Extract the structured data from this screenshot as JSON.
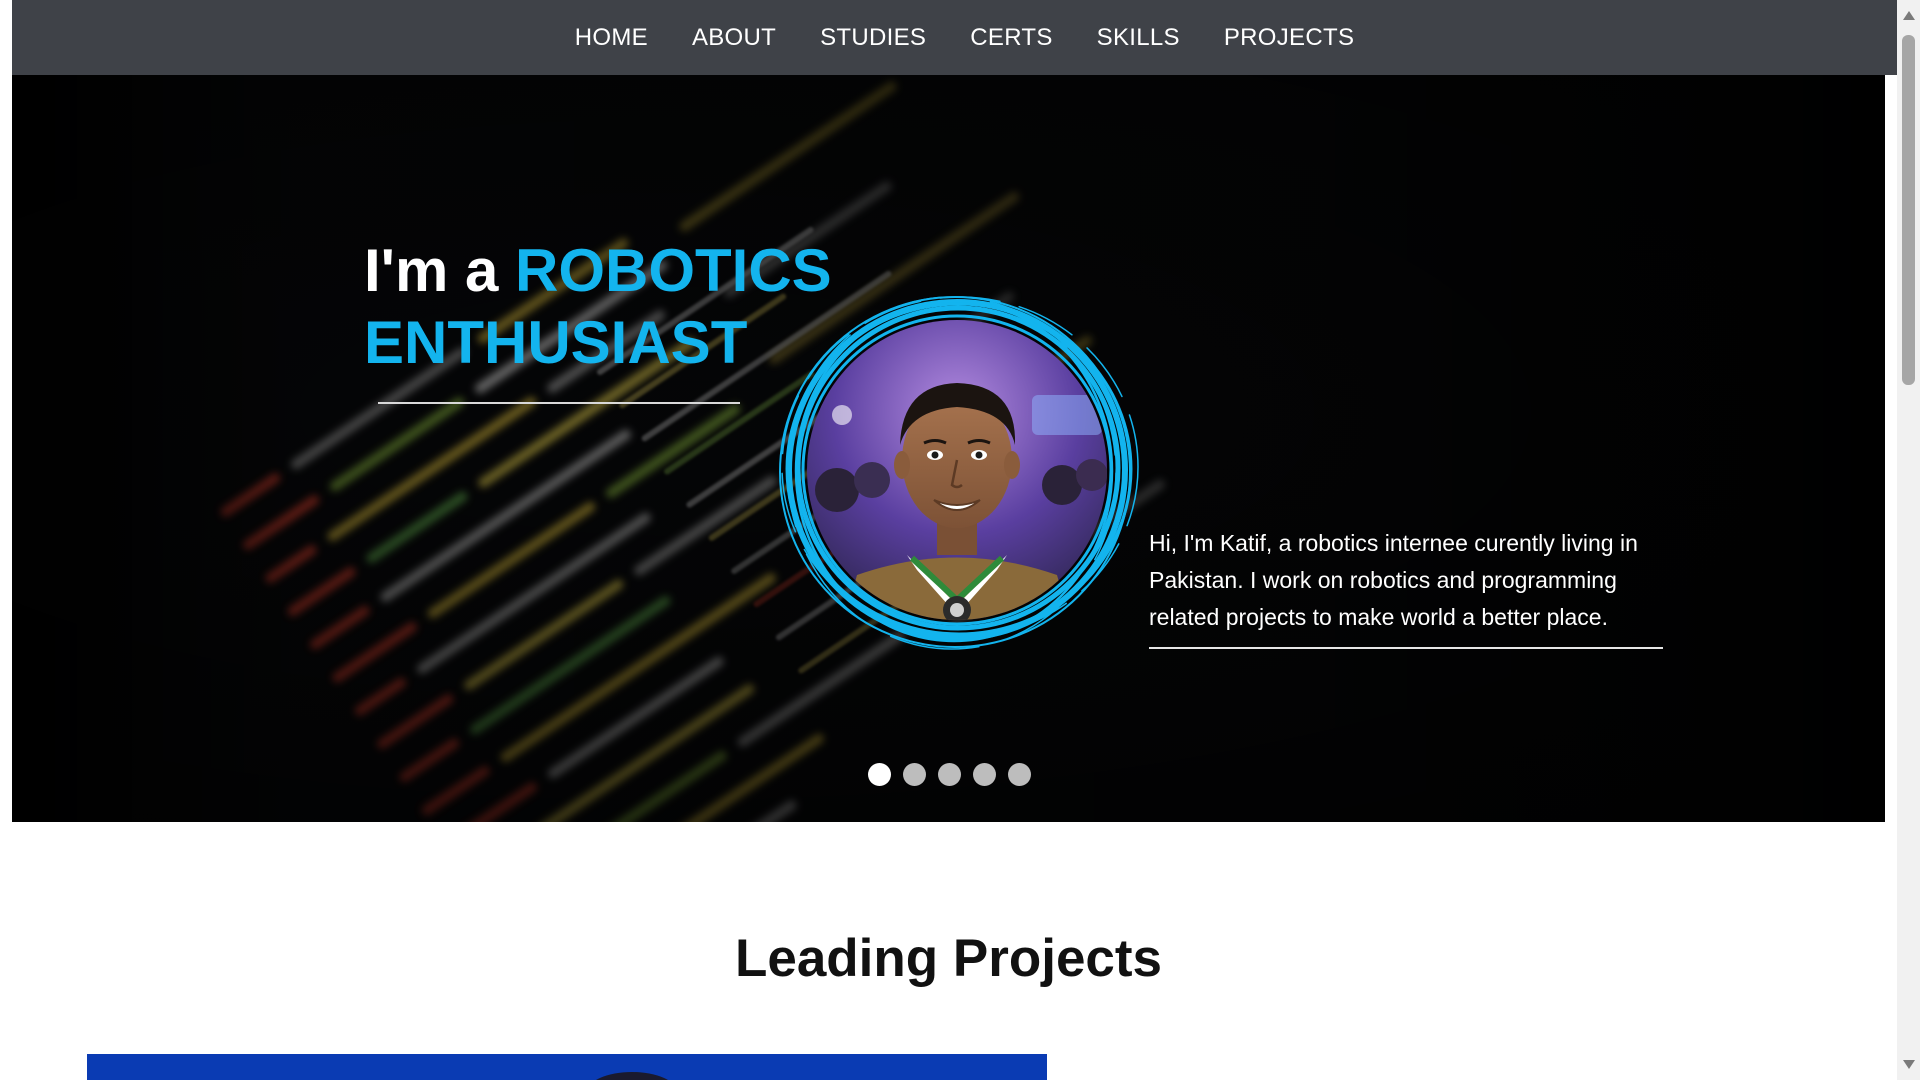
{
  "nav": {
    "items": [
      "HOME",
      "ABOUT",
      "STUDIES",
      "CERTS",
      "SKILLS",
      "PROJECTS"
    ]
  },
  "hero": {
    "headline_prefix": "I'm a ",
    "headline_accent_1": "ROBOTICS",
    "headline_accent_2": "ENTHUSIAST",
    "bio": "Hi, I'm Katif, a robotics internee curently living in Pakistan. I work on robotics and programming related projects to make world a better place.",
    "slide_count": 5,
    "active_slide": 1
  },
  "projects": {
    "title": "Leading Projects"
  },
  "colors": {
    "accent": "#13b4ee",
    "nav_bg": "#3f4248",
    "hero_bg": "#070809",
    "project_card": "#0a3bb3"
  }
}
